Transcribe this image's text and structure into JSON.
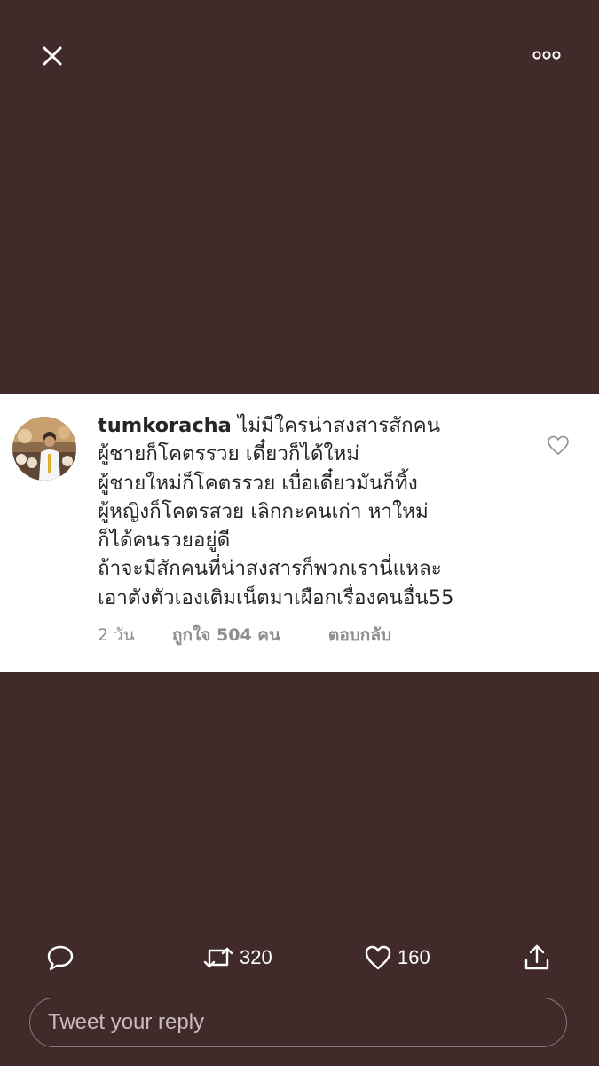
{
  "top_bar": {
    "close_icon": "close-icon",
    "more_icon": "more-horizontal-icon"
  },
  "comment": {
    "username": "tumkoracha",
    "lines": [
      "ไม่มีใครน่าสงสารสักคน",
      "ผู้ชายก็โคตรรวย เดี๋ยวก็ได้ใหม่",
      "ผู้ชายใหม่ก็โคตรรวย เบื่อเดี๋ยวมันก็ทิ้ง",
      "ผู้หญิงก็โคตรสวย เลิกกะคนเก่า หาใหม่",
      "ก็ได้คนรวยอยู่ดี",
      "ถ้าจะมีสักคนที่น่าสงสารก็พวกเรานี่แหละ",
      "เอาตังตัวเองเติมเน็ตมาเผือกเรื่องคนอื่น55"
    ],
    "time": "2 วัน",
    "likes": "ถูกใจ 504 คน",
    "reply": "ตอบกลับ",
    "heart_icon": "heart-outline-icon"
  },
  "actions": {
    "reply_icon": "comment-icon",
    "retweet_icon": "retweet-icon",
    "retweet_count": "320",
    "like_icon": "heart-icon",
    "like_count": "160",
    "share_icon": "share-icon"
  },
  "reply_input": {
    "placeholder": "Tweet your reply"
  },
  "colors": {
    "background": "#402b2a",
    "card": "#ffffff",
    "muted_text": "#8e8e8e"
  }
}
